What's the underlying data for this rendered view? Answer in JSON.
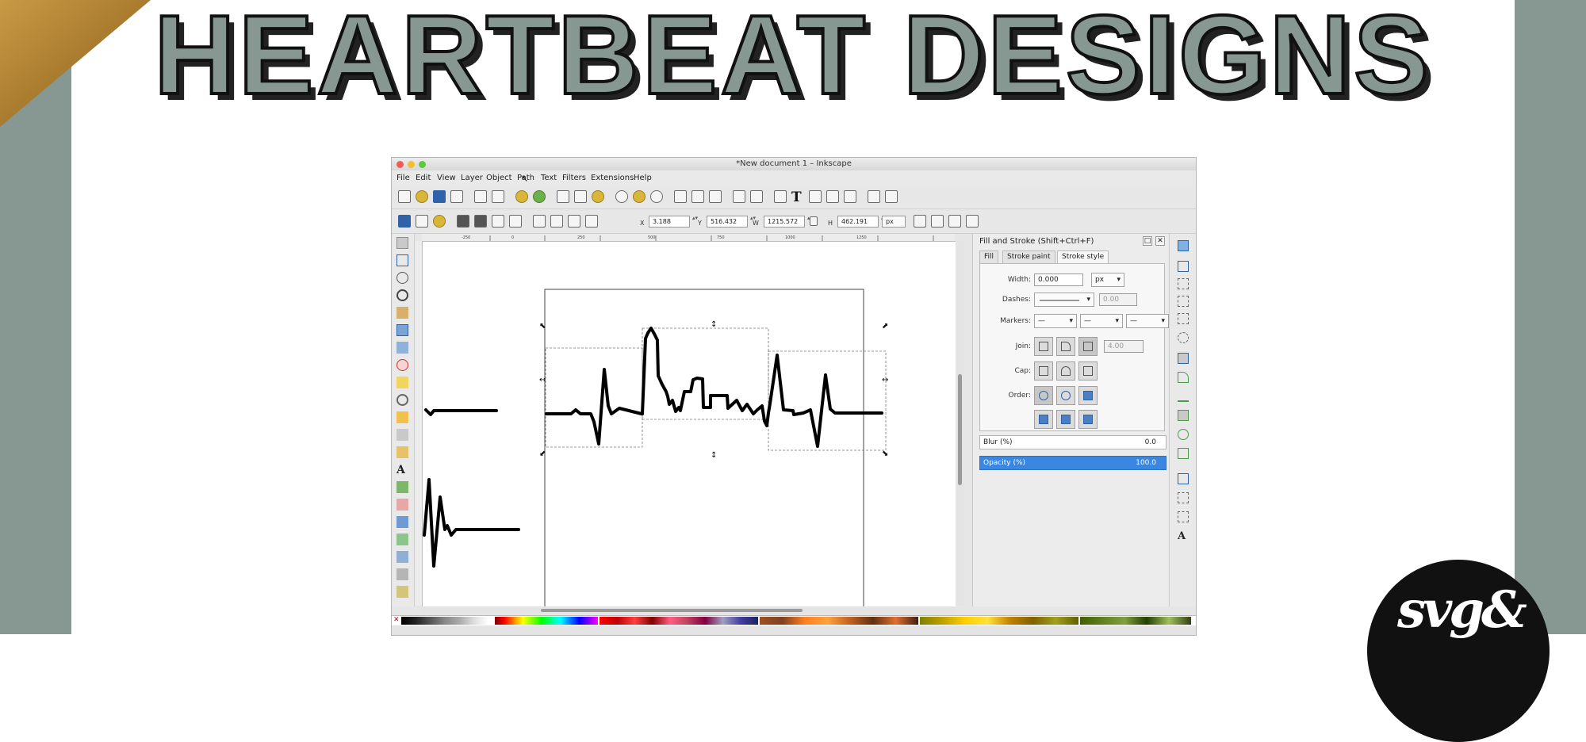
{
  "headline": {
    "text": "HEARTBEAT DESIGNS",
    "fill": "#869891",
    "stroke": "#111111",
    "shadow": "#222222"
  },
  "background": {
    "side_color": "#869891",
    "corner_color": "#b58a3a"
  },
  "logo": {
    "text": "svg&"
  },
  "window": {
    "title": "*New document 1 – Inkscape",
    "menu": [
      "File",
      "Edit",
      "View",
      "Layer",
      "Object",
      "Path",
      "Text",
      "Filters",
      "Extensions",
      "Help"
    ],
    "selection_toolbar": {
      "x_label": "X",
      "x_value": "3.188",
      "y_label": "Y",
      "y_value": "516.432",
      "w_label": "W",
      "w_value": "1215.572",
      "h_label": "H",
      "h_value": "462.191",
      "unit": "px"
    },
    "ruler_labels": [
      "-250",
      "0",
      "250",
      "500",
      "750",
      "1000",
      "1250"
    ],
    "dock": {
      "title": "Fill and Stroke (Shift+Ctrl+F)",
      "tabs": [
        "Fill",
        "Stroke paint",
        "Stroke style"
      ],
      "active_tab": "Stroke style",
      "width_label": "Width:",
      "width_value": "0.000",
      "width_unit": "px",
      "dashes_label": "Dashes:",
      "dashes_offset": "0.00",
      "markers_label": "Markers:",
      "join_label": "Join:",
      "miter_value": "4.00",
      "cap_label": "Cap:",
      "order_label": "Order:",
      "blur_label": "Blur (%)",
      "blur_value": "0.0",
      "opacity_label": "Opacity (%)",
      "opacity_value": "100.0"
    },
    "icons": {
      "toolbar": [
        "new-icon",
        "open-icon",
        "save-icon",
        "print-icon",
        "import-icon",
        "export-icon",
        "undo-icon",
        "redo-icon",
        "copy-icon",
        "cut-icon",
        "paste-icon",
        "zoom-selection-icon",
        "zoom-drawing-icon",
        "zoom-page-icon",
        "duplicate-icon",
        "clone-icon",
        "unlink-clone-icon",
        "group-icon",
        "ungroup-icon",
        "fill-stroke-icon",
        "text-font-icon",
        "layers-icon",
        "xml-editor-icon",
        "align-icon",
        "preferences-icon",
        "document-properties-icon"
      ]
    }
  }
}
